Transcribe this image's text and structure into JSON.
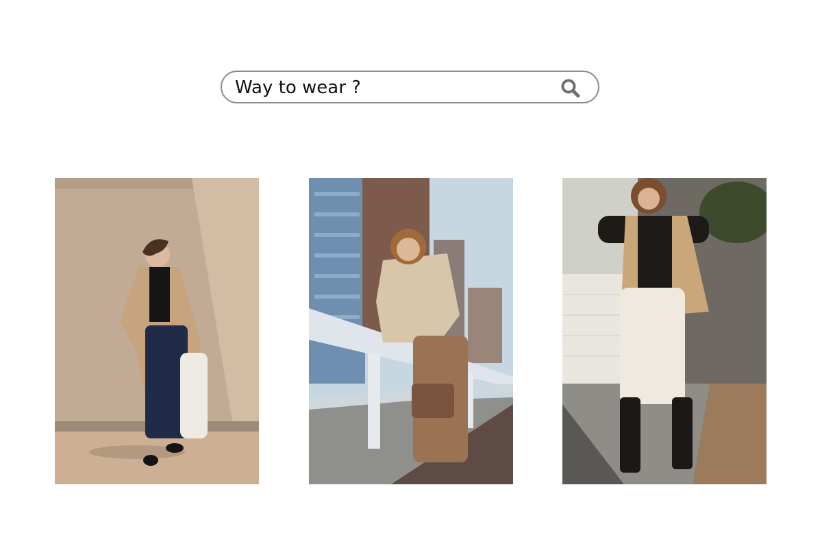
{
  "search": {
    "value": "Way to wear ?",
    "icon": "search-icon",
    "icon_color": "#6f6f6f",
    "border_color": "#8e8e8e"
  },
  "photos": [
    {
      "name": "outfit-photo-trench-coat",
      "description_icon": "photo",
      "palette": [
        "#bfa78e",
        "#1e2a45",
        "#c9aa82"
      ]
    },
    {
      "name": "outfit-photo-fleece-pullover",
      "description_icon": "photo",
      "palette": [
        "#6f8fb0",
        "#d8c6aa",
        "#9a7452"
      ]
    },
    {
      "name": "outfit-photo-puffer-vest",
      "description_icon": "photo",
      "palette": [
        "#c9a778",
        "#efe9df",
        "#2a2420"
      ]
    }
  ]
}
